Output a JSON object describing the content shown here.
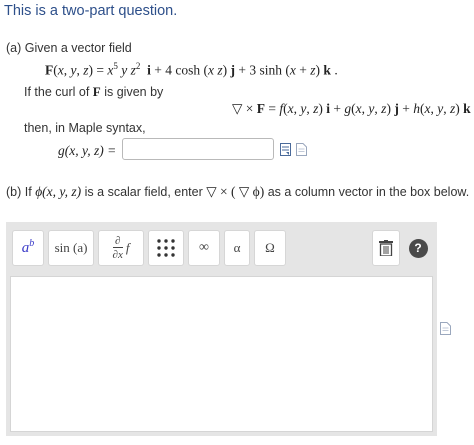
{
  "question": {
    "title": "This is a two-part question.",
    "part_a": {
      "intro": "(a) Given a vector field",
      "curl_intro": "If the curl of",
      "curl_F": "F",
      "curl_suffix": "is given by",
      "then_text": "then, in Maple syntax,",
      "g_label": "g(x, y, z) ="
    },
    "part_b": {
      "prefix": "(b) If",
      "phi_expr": "ϕ(x, y, z)",
      "middle": "is a scalar field, enter",
      "grad_expr": "▽ × ( ▽ ϕ)",
      "suffix": "as a column vector in the box below."
    }
  },
  "toolbar": {
    "superscript_label": "a",
    "superscript_exp": "b",
    "sin_label": "sin (a)",
    "partial_top": "∂",
    "partial_bottom": "∂x",
    "partial_f": "f",
    "matrix_label": "⋮⋮⋮",
    "infinity_label": "∞",
    "alpha_label": "α",
    "omega_label": "Ω",
    "help_label": "?"
  },
  "colors": {
    "title": "#2d4f8a",
    "toolbar_bg": "#e5e5e5",
    "help_bg": "#4a4a4a"
  }
}
